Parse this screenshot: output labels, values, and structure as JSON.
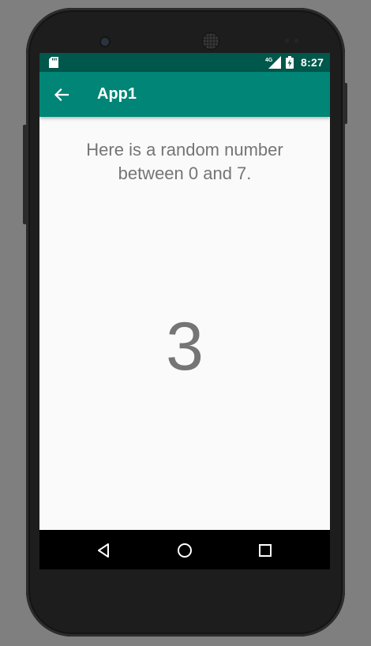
{
  "status_bar": {
    "time": "8:27",
    "network_label": "4G",
    "icons": [
      "sd-card-icon",
      "signal-icon",
      "battery-charging-icon"
    ]
  },
  "app_bar": {
    "title": "App1",
    "back_icon": "arrow-back-icon",
    "color": "#008577"
  },
  "content": {
    "prompt": "Here is a random number between 0 and 7.",
    "number": "3"
  },
  "nav_bar": {
    "buttons": [
      "back-triangle-icon",
      "home-circle-icon",
      "recents-square-icon"
    ]
  },
  "colors": {
    "status_bar": "#00574b",
    "app_bar": "#008577",
    "text": "#757575",
    "background": "#fafafa"
  }
}
